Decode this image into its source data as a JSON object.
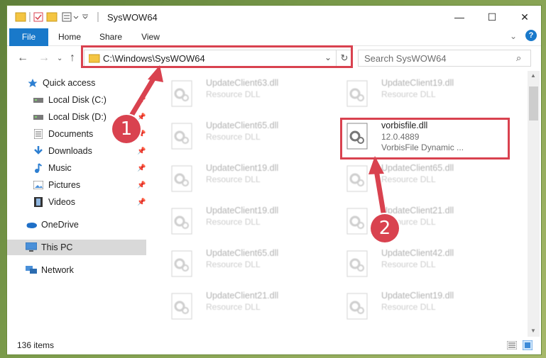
{
  "window": {
    "title": "SysWOW64",
    "controls": {
      "minimize": "—",
      "maximize": "☐",
      "close": "✕"
    }
  },
  "ribbon": {
    "tabs": [
      {
        "label": "File"
      },
      {
        "label": "Home"
      },
      {
        "label": "Share"
      },
      {
        "label": "View"
      }
    ]
  },
  "address": {
    "path": "C:\\Windows\\SysWOW64",
    "search_placeholder": "Search SysWOW64"
  },
  "sidebar": {
    "items": [
      {
        "label": "Quick access",
        "icon": "star-icon"
      },
      {
        "label": "Local Disk (C:)",
        "icon": "drive-icon"
      },
      {
        "label": "Local Disk (D:)",
        "icon": "drive-icon"
      },
      {
        "label": "Documents",
        "icon": "documents-icon"
      },
      {
        "label": "Downloads",
        "icon": "download-icon"
      },
      {
        "label": "Music",
        "icon": "music-icon"
      },
      {
        "label": "Pictures",
        "icon": "pictures-icon"
      },
      {
        "label": "Videos",
        "icon": "videos-icon"
      },
      {
        "label": "OneDrive",
        "icon": "cloud-icon"
      },
      {
        "label": "This PC",
        "icon": "monitor-icon"
      },
      {
        "label": "Network",
        "icon": "network-icon"
      }
    ]
  },
  "files": {
    "left": [
      {
        "name": "UpdateClient63.dll",
        "type": "Resource DLL"
      },
      {
        "name": "UpdateClient65.dll",
        "type": "Resource DLL"
      },
      {
        "name": "UpdateClient19.dll",
        "type": "Resource DLL"
      },
      {
        "name": "UpdateClient19.dll",
        "type": "Resource DLL"
      },
      {
        "name": "UpdateClient65.dll",
        "type": "Resource DLL"
      },
      {
        "name": "UpdateClient21.dll",
        "type": "Resource DLL"
      }
    ],
    "right": [
      {
        "name": "UpdateClient19.dll",
        "type": "Resource DLL"
      },
      {
        "name": "vorbisfile.dll",
        "type": "12.0.4889",
        "desc": "VorbisFile Dynamic ..."
      },
      {
        "name": "UpdateClient65.dll",
        "type": "Resource DLL"
      },
      {
        "name": "UpdateClient21.dll",
        "type": "Resource DLL"
      },
      {
        "name": "UpdateClient42.dll",
        "type": "Resource DLL"
      },
      {
        "name": "UpdateClient19.dll",
        "type": "Resource DLL"
      }
    ]
  },
  "status": {
    "items_count": "136 items"
  },
  "annotations": {
    "step1": "1",
    "step2": "2",
    "color": "#d9424f"
  }
}
